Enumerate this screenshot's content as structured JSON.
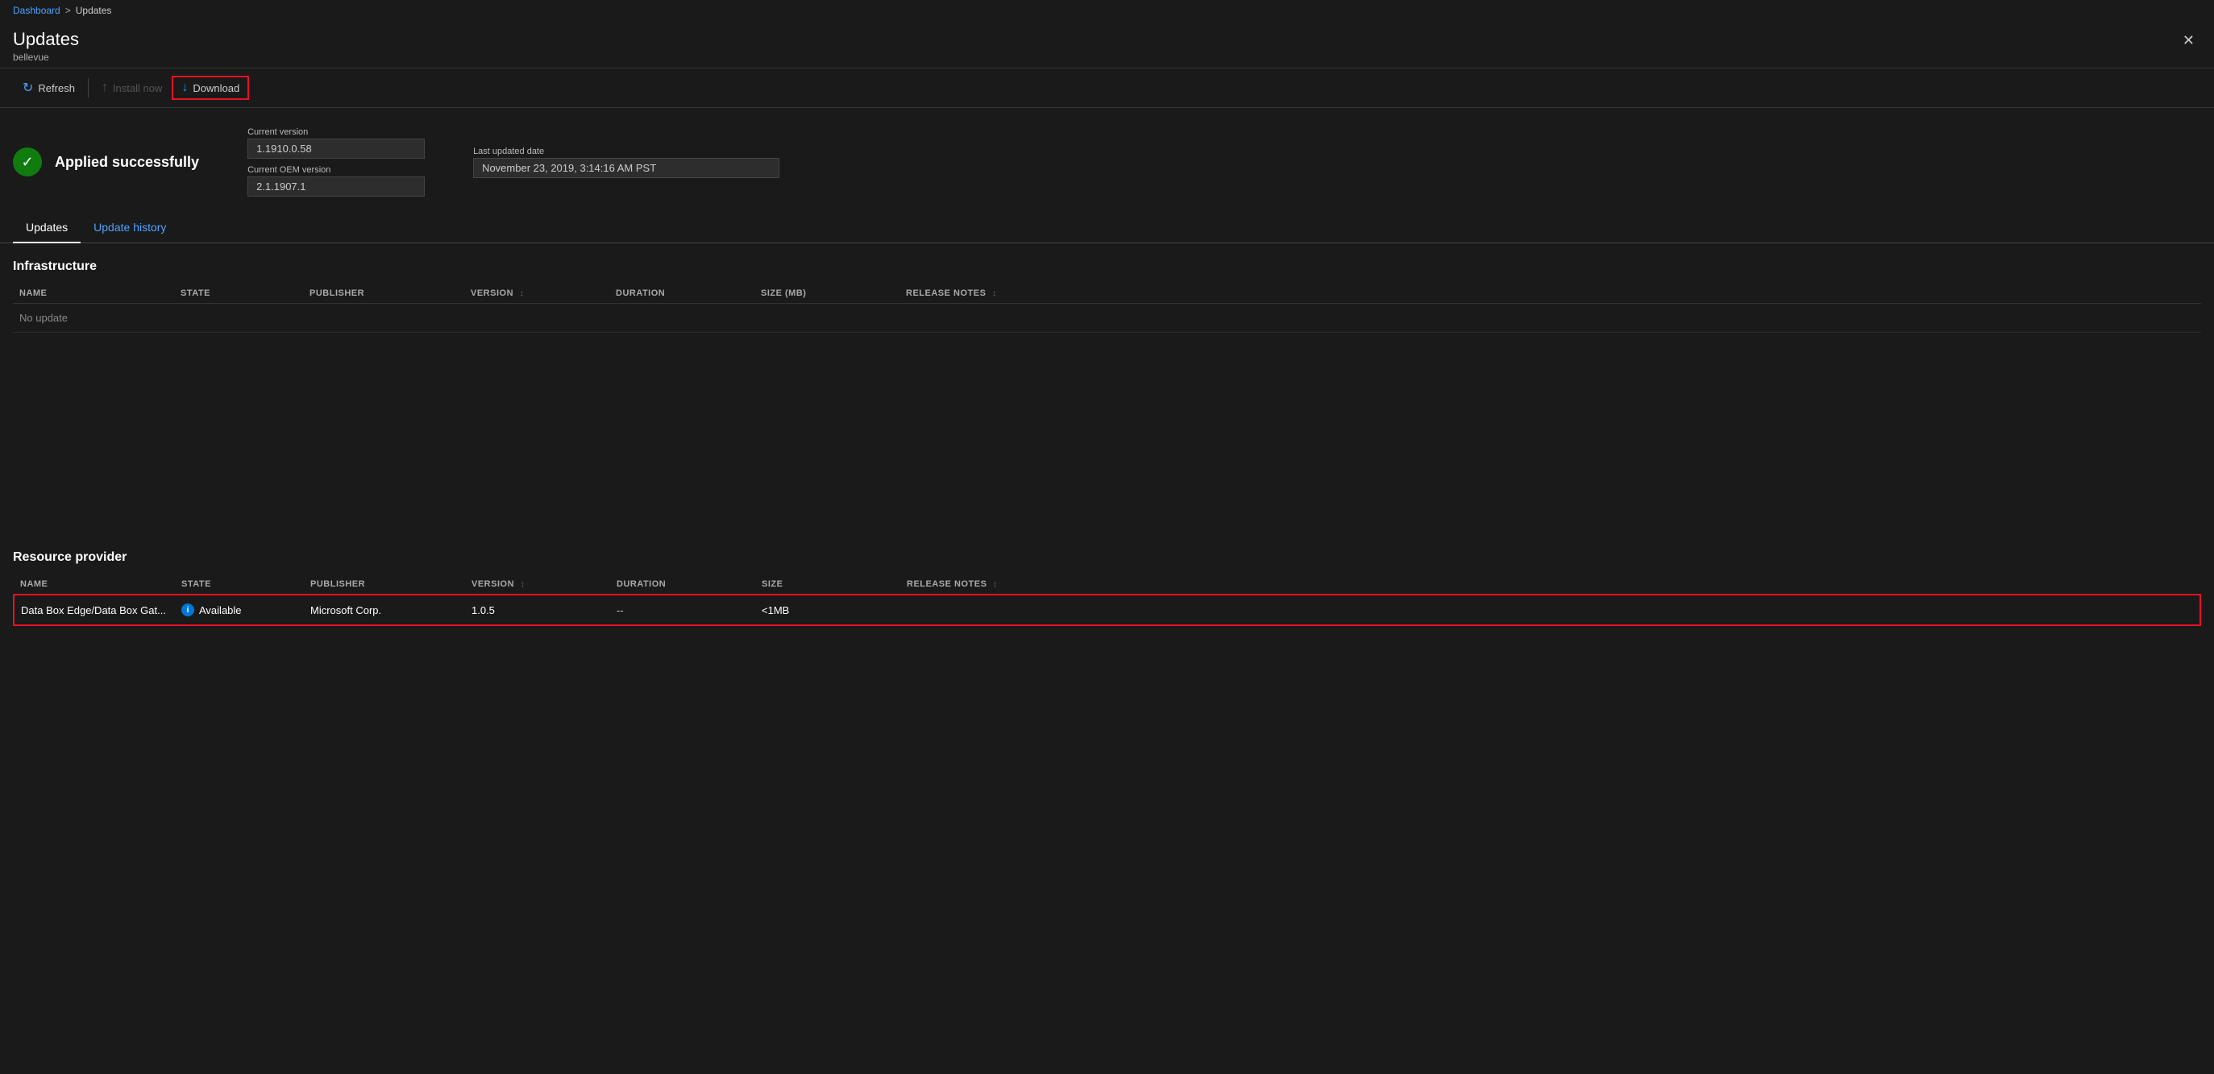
{
  "breadcrumb": {
    "dashboard_label": "Dashboard",
    "separator": ">",
    "current_label": "Updates"
  },
  "header": {
    "title": "Updates",
    "subtitle": "bellevue",
    "close_label": "✕"
  },
  "toolbar": {
    "refresh_label": "Refresh",
    "install_now_label": "Install now",
    "download_label": "Download"
  },
  "status": {
    "applied_label": "Applied successfully",
    "current_version_label": "Current version",
    "current_version_value": "1.1910.0.58",
    "current_oem_version_label": "Current OEM version",
    "current_oem_version_value": "2.1.1907.1",
    "last_updated_label": "Last updated date",
    "last_updated_value": "November 23, 2019, 3:14:16 AM PST"
  },
  "tabs": [
    {
      "id": "updates",
      "label": "Updates",
      "active": true
    },
    {
      "id": "update-history",
      "label": "Update history",
      "active": false
    }
  ],
  "infrastructure": {
    "section_title": "Infrastructure",
    "columns": [
      {
        "id": "name",
        "label": "NAME"
      },
      {
        "id": "state",
        "label": "STATE"
      },
      {
        "id": "publisher",
        "label": "PUBLISHER"
      },
      {
        "id": "version",
        "label": "VERSION"
      },
      {
        "id": "duration",
        "label": "DURATION"
      },
      {
        "id": "size_mb",
        "label": "SIZE (MB)"
      },
      {
        "id": "release_notes",
        "label": "RELEASE NOTES"
      }
    ],
    "rows": [
      {
        "name": "No update",
        "state": "",
        "publisher": "",
        "version": "",
        "duration": "",
        "size_mb": "",
        "release_notes": ""
      }
    ]
  },
  "resource_provider": {
    "section_title": "Resource provider",
    "columns": [
      {
        "id": "name",
        "label": "NAME"
      },
      {
        "id": "state",
        "label": "STATE"
      },
      {
        "id": "publisher",
        "label": "PUBLISHER"
      },
      {
        "id": "version",
        "label": "VERSION"
      },
      {
        "id": "duration",
        "label": "DURATION"
      },
      {
        "id": "size",
        "label": "SIZE"
      },
      {
        "id": "release_notes",
        "label": "RELEASE NOTES"
      }
    ],
    "rows": [
      {
        "name": "Data Box Edge/Data Box Gat...",
        "state": "Available",
        "publisher": "Microsoft Corp.",
        "version": "1.0.5",
        "duration": "--",
        "size": "<1MB",
        "release_notes": "",
        "highlighted": true
      }
    ]
  },
  "icons": {
    "refresh": "↻",
    "install": "↑",
    "download": "↓",
    "check": "✓",
    "info": "i",
    "sort": "↕"
  }
}
